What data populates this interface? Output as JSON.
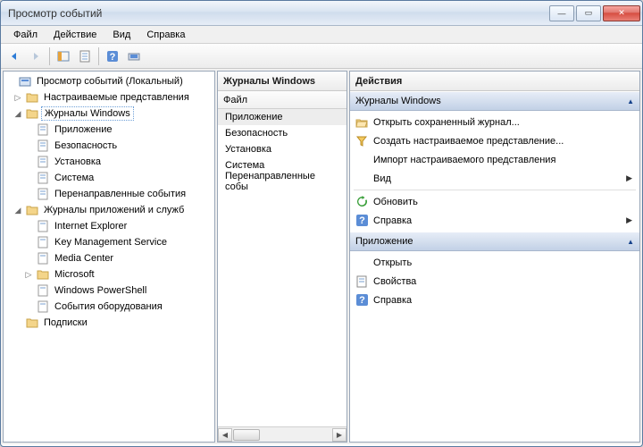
{
  "window": {
    "title": "Просмотр событий"
  },
  "menu": {
    "file": "Файл",
    "action": "Действие",
    "view": "Вид",
    "help": "Справка"
  },
  "tree": {
    "root": "Просмотр событий (Локальный)",
    "custom": "Настраиваемые представления",
    "winlogs": "Журналы Windows",
    "application": "Приложение",
    "security": "Безопасность",
    "setup": "Установка",
    "system": "Система",
    "forwarded": "Перенаправленные события",
    "appsvc": "Журналы приложений и служб",
    "ie": "Internet Explorer",
    "kms": "Key Management Service",
    "mc": "Media Center",
    "ms": "Microsoft",
    "ps": "Windows PowerShell",
    "hw": "События оборудования",
    "subs": "Подписки"
  },
  "mid": {
    "header": "Журналы Windows",
    "col": "Файл",
    "rows": [
      "Приложение",
      "Безопасность",
      "Установка",
      "Система",
      "Перенаправленные собы"
    ]
  },
  "actions": {
    "header": "Действия",
    "sec1": "Журналы Windows",
    "open_saved": "Открыть сохраненный журнал...",
    "create_view": "Создать настраиваемое представление...",
    "import_view": "Импорт настраиваемого представления",
    "view": "Вид",
    "refresh": "Обновить",
    "help": "Справка",
    "sec2": "Приложение",
    "open": "Открыть",
    "props": "Свойства",
    "help2": "Справка"
  }
}
